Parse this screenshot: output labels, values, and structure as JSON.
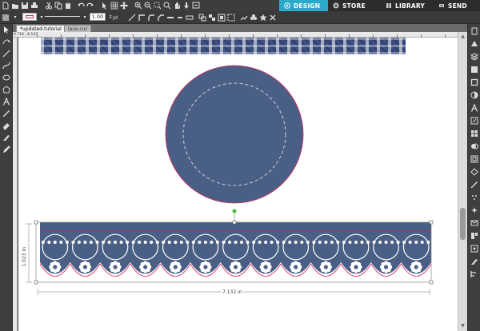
{
  "topbar": {
    "stroke_width": "1.00",
    "stroke_unit": "pt",
    "accent_color": "#2aa9c9"
  },
  "nav_tabs": [
    {
      "label": "DESIGN",
      "icon": "design-icon",
      "active": true
    },
    {
      "label": "STORE",
      "icon": "store-icon",
      "active": false
    },
    {
      "label": "LIBRARY",
      "icon": "library-icon",
      "active": false
    },
    {
      "label": "SEND",
      "icon": "send-icon",
      "active": false
    }
  ],
  "document_tabs": [
    {
      "label": "*updated-tutorial",
      "active": true
    },
    {
      "label": "lace-cut",
      "active": false
    }
  ],
  "ruler": {
    "coord_readout": "6.716 , 8.147"
  },
  "canvas": {
    "width_dimension": "7.132 in",
    "height_dimension": "1.023 in",
    "colors": {
      "navy": "#4a5f85",
      "cut_line": "#d2245a",
      "selection": "#5a5a5a",
      "rotate_handle": "#3fbf3f"
    }
  }
}
